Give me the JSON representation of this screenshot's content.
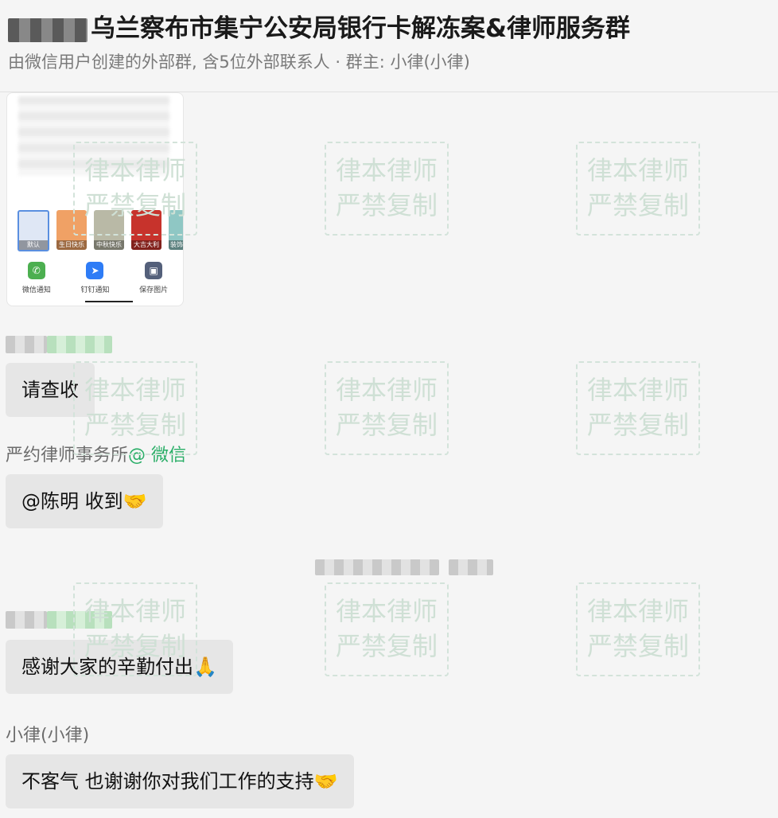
{
  "header": {
    "title": "乌兰察布市集宁公安局银行卡解冻案&律师服务群",
    "subtitle": "由微信用户创建的外部群, 含5位外部联系人 · 群主: 小律(小律)"
  },
  "watermark": {
    "line1": "律本律师",
    "line2": "严禁复制"
  },
  "image_card": {
    "thumbnails": [
      "默认",
      "生日快乐",
      "中秋快乐",
      "大吉大利",
      "装饰"
    ],
    "share_options": [
      {
        "label": "微信通知",
        "icon": "wechat-icon",
        "color": "#4caf50"
      },
      {
        "label": "钉钉通知",
        "icon": "dingtalk-icon",
        "color": "#2e7cf6"
      },
      {
        "label": "保存图片",
        "icon": "save-image-icon",
        "color": "#54607a"
      }
    ]
  },
  "messages": [
    {
      "sender": "",
      "sender_blurred": true,
      "text": "请查收"
    },
    {
      "sender": "严约律师事务所",
      "sender_tag": "@ 微信",
      "text": "@陈明 收到🤝"
    },
    {
      "sender": "",
      "sender_blurred": true,
      "text": "感谢大家的辛勤付出🙏"
    },
    {
      "sender": "小律(小律)",
      "text": "不客气 也谢谢你对我们工作的支持🤝"
    }
  ]
}
